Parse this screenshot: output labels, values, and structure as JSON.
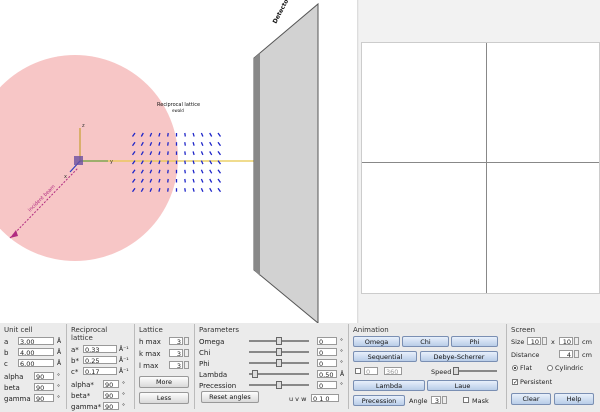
{
  "scene": {
    "label_title": "Reciprocal lattice",
    "label_sub": "ewald",
    "axis_x": "x",
    "axis_y": "y",
    "axis_z": "z",
    "beam_label": "incident beam",
    "screen_label": "Detector screen"
  },
  "unit_cell": {
    "title": "Unit cell",
    "a_label": "a",
    "a_value": "3.00",
    "a_unit": "Å",
    "b_label": "b",
    "b_value": "4.00",
    "b_unit": "Å",
    "c_label": "c",
    "c_value": "6.00",
    "c_unit": "Å",
    "alpha_label": "alpha",
    "alpha_value": "90",
    "alpha_unit": "°",
    "beta_label": "beta",
    "beta_value": "90",
    "beta_unit": "°",
    "gamma_label": "gamma",
    "gamma_value": "90",
    "gamma_unit": "°"
  },
  "reciprocal": {
    "title": "Reciprocal lattice",
    "a_label": "a*",
    "a_value": "0.33",
    "a_unit": "Å⁻¹",
    "b_label": "b*",
    "b_value": "0.25",
    "b_unit": "Å⁻¹",
    "c_label": "c*",
    "c_value": "0.17",
    "c_unit": "Å⁻¹",
    "alpha_label": "alpha*",
    "alpha_value": "90",
    "alpha_unit": "°",
    "beta_label": "beta*",
    "beta_value": "90",
    "beta_unit": "°",
    "gamma_label": "gamma*",
    "gamma_value": "90",
    "gamma_unit": "°"
  },
  "lattice": {
    "title": "Lattice",
    "h_label": "h max",
    "h_value": "3",
    "k_label": "k max",
    "k_value": "3",
    "l_label": "l max",
    "l_value": "3",
    "more_label": "More",
    "less_label": "Less"
  },
  "parameters": {
    "title": "Parameters",
    "omega_label": "Omega",
    "omega_value": "0",
    "omega_level": 0.5,
    "chi_label": "Chi",
    "chi_value": "0",
    "chi_level": 0.5,
    "phi_label": "Phi",
    "phi_value": "0",
    "phi_level": 0.5,
    "lambda_label": "Lambda",
    "lambda_value": "0.50",
    "lambda_level": 0.05,
    "precession_label": "Precession",
    "precession_value": "0",
    "precession_level": 0.5,
    "deg": "°",
    "angstrom": "Å",
    "reset_label": "Reset angles",
    "uvw_label": "u v w",
    "uvw_value": "0 1 0"
  },
  "animation": {
    "title": "Animation",
    "omega_label": "Omega",
    "chi_label": "Chi",
    "phi_label": "Phi",
    "sequential_label": "Sequential",
    "debye_label": "Debye-Scherrer",
    "range_from": "0",
    "range_to": "360",
    "speed_label": "Speed",
    "lambda_label": "Lambda",
    "laue_label": "Laue",
    "precession_label": "Precession",
    "angle_label": "Angle",
    "angle_value": "3",
    "mask_label": "Mask"
  },
  "screen": {
    "title": "Screen",
    "size_label": "Size",
    "size_w": "10",
    "size_x": "x",
    "size_h": "10",
    "size_unit": "cm",
    "distance_label": "Distance",
    "distance_value": "4",
    "distance_unit": "cm",
    "flat_label": "Flat",
    "cyl_label": "Cylindric",
    "persistent_label": "Persistent",
    "clear_label": "Clear",
    "help_label": "Help"
  },
  "colors": {
    "ewald_sphere": "#f6bcbc",
    "lattice_points": "#1e25c8",
    "beam": "#e8c84a",
    "button_blue": "#b9cde8"
  }
}
